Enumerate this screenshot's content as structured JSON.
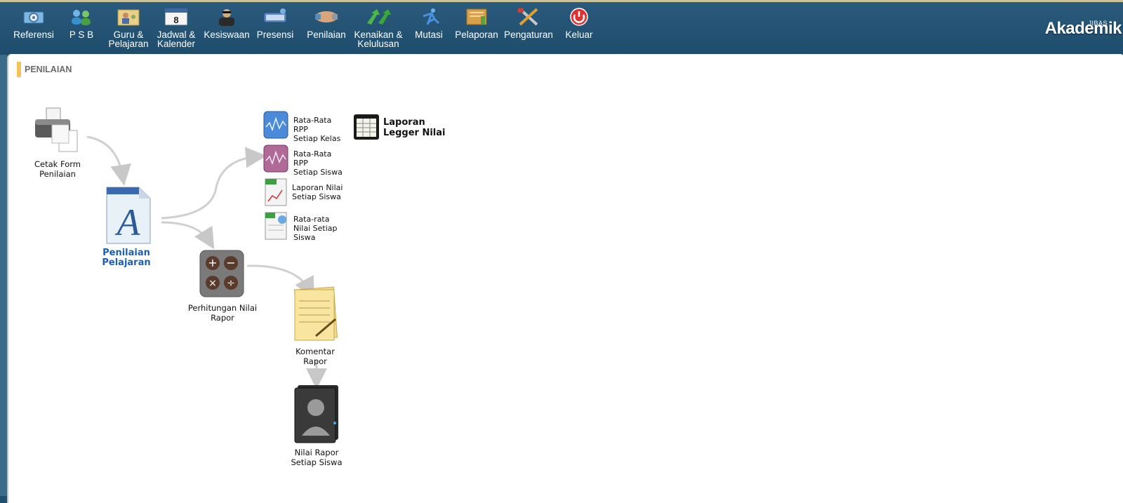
{
  "nav": [
    {
      "label_1": "Referensi",
      "label_2": "",
      "icon": "gear-icon"
    },
    {
      "label_1": "P S B",
      "label_2": "",
      "icon": "users-icon"
    },
    {
      "label_1": "Guru &",
      "label_2": "Pelajaran",
      "icon": "teacher-icon"
    },
    {
      "label_1": "Jadwal &",
      "label_2": "Kalender",
      "icon": "calendar-icon"
    },
    {
      "label_1": "Kesiswaan",
      "label_2": "",
      "icon": "student-icon"
    },
    {
      "label_1": "Presensi",
      "label_2": "",
      "icon": "presence-icon"
    },
    {
      "label_1": "Penilaian",
      "label_2": "",
      "icon": "handshake-icon"
    },
    {
      "label_1": "Kenaikan &",
      "label_2": "Kelulusan",
      "icon": "arrows-up-icon"
    },
    {
      "label_1": "Mutasi",
      "label_2": "",
      "icon": "runner-icon"
    },
    {
      "label_1": "Pelaporan",
      "label_2": "",
      "icon": "report-icon"
    },
    {
      "label_1": "Pengaturan",
      "label_2": "",
      "icon": "tools-icon"
    },
    {
      "label_1": "Keluar",
      "label_2": "",
      "icon": "power-icon"
    }
  ],
  "brand": {
    "small": "JIBAS",
    "name": "Akademik"
  },
  "page": {
    "title": "PENILAIAN"
  },
  "flow": {
    "cetak_form": {
      "line1": "Cetak Form",
      "line2": "Penilaian"
    },
    "penilaian_pelajaran": "Penilaian Pelajaran",
    "perhitungan": "Perhitungan Nilai Rapor",
    "komentar": "Komentar Rapor",
    "nilai_rapor": {
      "line1": "Nilai Rapor",
      "line2": "Setiap Siswa"
    },
    "rpp_kelas": {
      "line1": "Rata-Rata RPP",
      "line2": "Setiap Kelas"
    },
    "rpp_siswa": {
      "line1": "Rata-Rata RPP",
      "line2": "Setiap Siswa"
    },
    "laporan_nilai": {
      "line1": "Laporan Nilai",
      "line2": "Setiap Siswa"
    },
    "rata_nilai": {
      "line1": "Rata-rata",
      "line2": "Nilai Setiap",
      "line3": "Siswa"
    },
    "legger": {
      "line1": "Laporan",
      "line2": "Legger Nilai"
    }
  },
  "colors": {
    "accent": "#f6c25a",
    "topbar": "#245677",
    "link": "#1a5fb4"
  }
}
